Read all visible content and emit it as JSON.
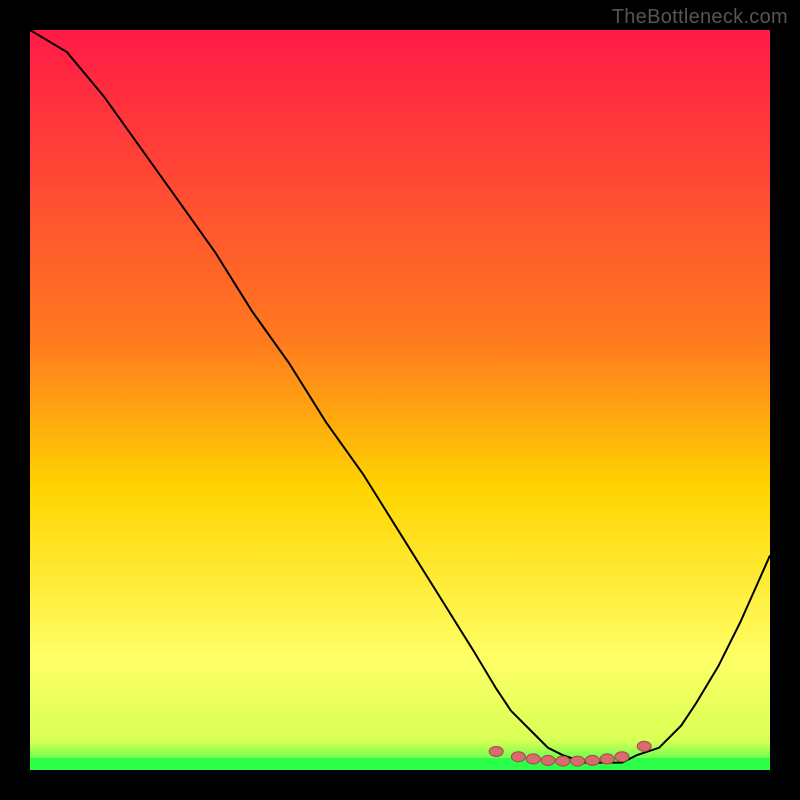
{
  "watermark": "TheBottleneck.com",
  "colors": {
    "bg": "#000000",
    "curve": "#000000",
    "dots_fill": "#d96b6b",
    "dots_stroke": "#a34b4b",
    "green_band": "#2bff4a",
    "grad_top": "#ff1a47",
    "grad_mid": "#ffd400",
    "grad_low": "#ffff66",
    "grad_bottom": "#2bff4a",
    "watermark_text": "#555555"
  },
  "chart_data": {
    "type": "line",
    "title": "",
    "xlabel": "",
    "ylabel": "",
    "xlim": [
      0,
      100
    ],
    "ylim": [
      0,
      100
    ],
    "series": [
      {
        "name": "bottleneck-curve",
        "x": [
          0,
          5,
          10,
          15,
          20,
          25,
          30,
          35,
          40,
          45,
          50,
          55,
          60,
          63,
          65,
          68,
          70,
          72,
          75,
          78,
          80,
          82,
          85,
          88,
          90,
          93,
          96,
          100
        ],
        "y": [
          100,
          97,
          91,
          84,
          77,
          70,
          62,
          55,
          47,
          40,
          32,
          24,
          16,
          11,
          8,
          5,
          3,
          2,
          1,
          1,
          1,
          2,
          3,
          6,
          9,
          14,
          20,
          29
        ]
      }
    ],
    "highlight_dots": {
      "name": "optimal-range-markers",
      "x": [
        63,
        66,
        68,
        70,
        72,
        74,
        76,
        78,
        80,
        83
      ],
      "y": [
        2.5,
        1.8,
        1.5,
        1.3,
        1.2,
        1.2,
        1.3,
        1.5,
        1.8,
        3.2
      ]
    }
  }
}
